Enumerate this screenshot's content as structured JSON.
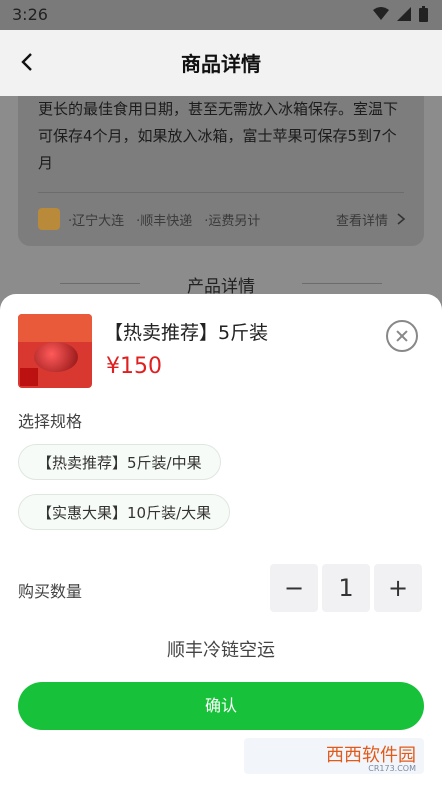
{
  "status": {
    "time": "3:26"
  },
  "nav": {
    "title": "商品详情"
  },
  "background": {
    "description": "更长的最佳食用日期，甚至无需放入冰箱保存。室温下可保存4个月，如果放入冰箱，富士苹果可保存5到7个月",
    "origin": "·辽宁大连",
    "shipping": "·顺丰快递",
    "fee": "·运费另计",
    "detail_link": "查看详情",
    "section_title": "产品详情"
  },
  "sheet": {
    "product_name": "【热卖推荐】5斤装",
    "price": "¥150",
    "spec_label": "选择规格",
    "specs": [
      "【热卖推荐】5斤装/中果",
      "【实惠大果】10斤装/大果"
    ],
    "qty_label": "购买数量",
    "qty_value": "1",
    "minus": "−",
    "plus": "+",
    "shipping_note": "顺丰冷链空运",
    "confirm": "确认"
  },
  "watermark": {
    "text": "西西软件园",
    "sub": "CR173.COM"
  },
  "colors": {
    "accent": "#17c23a",
    "price": "#e02020"
  }
}
